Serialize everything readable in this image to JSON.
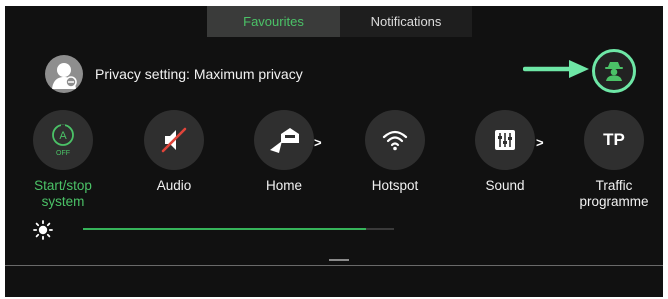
{
  "tabs": [
    {
      "label": "Favourites",
      "active": true
    },
    {
      "label": "Notifications",
      "active": false
    }
  ],
  "privacy": {
    "text": "Privacy setting: Maximum privacy",
    "avatar_icon": "user-privacy-icon",
    "status_icon": "incognito-user-icon"
  },
  "annotation": {
    "arrow_color": "#6ee7a6"
  },
  "tiles": [
    {
      "label": "Start/stop system",
      "icon": "start-stop-off-icon",
      "active": true,
      "sub": "OFF",
      "glyph": "A"
    },
    {
      "label": "Audio",
      "icon": "audio-muted-icon",
      "active": false
    },
    {
      "label": "Home",
      "icon": "home-navigation-icon",
      "active": false,
      "has_chevron": true
    },
    {
      "label": "Hotspot",
      "icon": "wifi-icon",
      "active": false
    },
    {
      "label": "Sound",
      "icon": "equalizer-icon",
      "active": false,
      "has_chevron": true
    },
    {
      "label": "Traffic programme",
      "icon": "tp-icon",
      "active": false,
      "glyph": "TP"
    }
  ],
  "brightness": {
    "icon": "brightness-icon",
    "level": 0.91
  },
  "colors": {
    "accent": "#4bc267",
    "background": "#111111",
    "tile": "#2f2f2f"
  }
}
